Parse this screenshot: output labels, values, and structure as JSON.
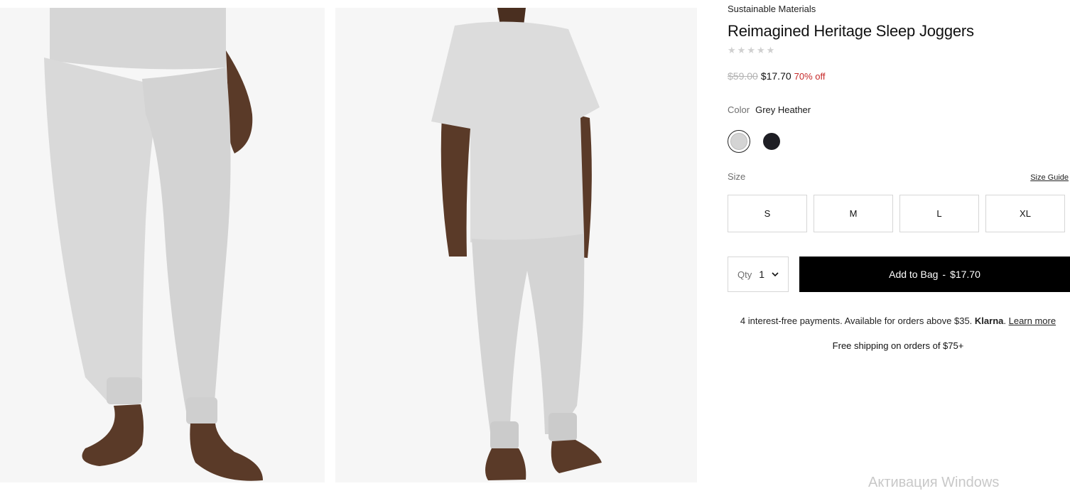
{
  "product": {
    "eyebrow": "Sustainable Materials",
    "title": "Reimagined Heritage Sleep Joggers",
    "rating_stars": 5,
    "rating_filled": 0,
    "price_original": "$59.00",
    "price_sale": "$17.70",
    "discount": "70% off"
  },
  "color": {
    "label": "Color",
    "selected": "Grey Heather",
    "swatches": [
      {
        "name": "Grey Heather",
        "hex": "#d4d4d4",
        "selected": true
      },
      {
        "name": "Black",
        "hex": "#1e1e24",
        "selected": false
      }
    ]
  },
  "size": {
    "label": "Size",
    "guide": "Size Guide",
    "options": [
      "S",
      "M",
      "L",
      "XL"
    ]
  },
  "qty": {
    "label": "Qty",
    "value": "1"
  },
  "add_to_bag": {
    "label": "Add to Bag",
    "separator": "-",
    "price": "$17.70"
  },
  "klarna": {
    "text": "4 interest-free payments. Available for orders above $35.",
    "brand": "Klarna",
    "link": "Learn more"
  },
  "shipping": "Free shipping on orders of $75+",
  "photos": [
    {
      "name": "front-view-photo"
    },
    {
      "name": "back-view-photo"
    }
  ],
  "colors": {
    "photo_bg": "#f6f6f6",
    "garment": "#d9d9d9",
    "skin": "#5a3a28",
    "sale": "#c62828",
    "button": "#000000"
  },
  "watermark": "Активация Windows"
}
